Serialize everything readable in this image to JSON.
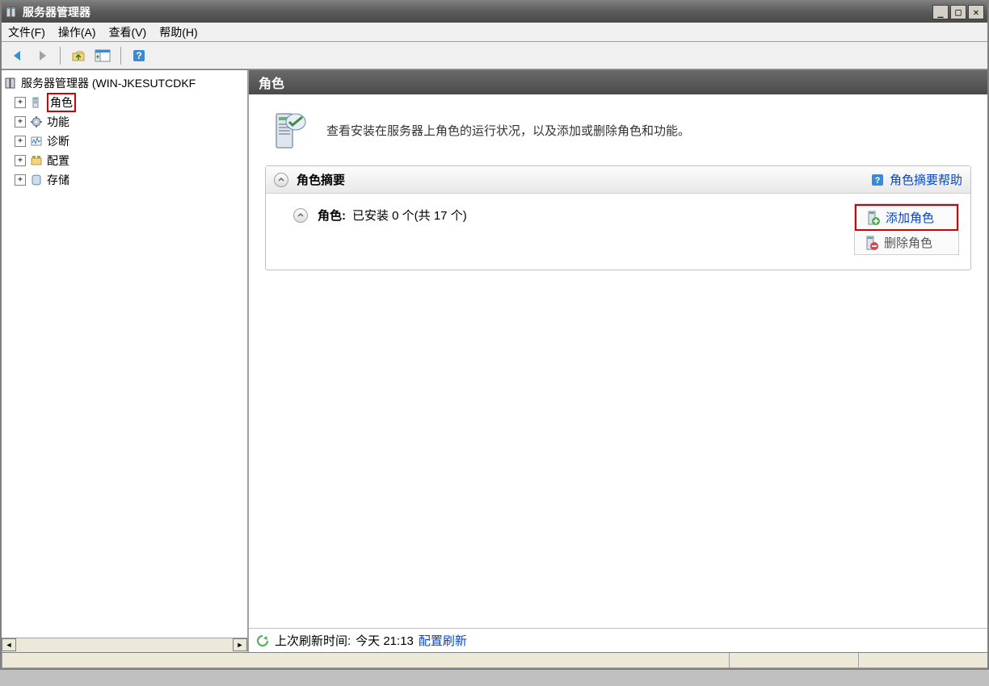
{
  "window": {
    "title": "服务器管理器"
  },
  "menubar": {
    "file": "文件(F)",
    "action": "操作(A)",
    "view": "查看(V)",
    "help": "帮助(H)"
  },
  "tree": {
    "root": "服务器管理器 (WIN-JKESUTCDKF",
    "items": {
      "roles": "角色",
      "features": "功能",
      "diagnostics": "诊断",
      "configuration": "配置",
      "storage": "存储"
    }
  },
  "main": {
    "header": "角色",
    "banner": "查看安装在服务器上角色的运行状况，以及添加或删除角色和功能。",
    "summary": {
      "title": "角色摘要",
      "help": "角色摘要帮助"
    },
    "roles": {
      "label": "角色:",
      "installed": "已安装 0 个(共 17 个)",
      "add": "添加角色",
      "remove": "删除角色"
    },
    "status": {
      "prefix": "上次刷新时间:",
      "time": "今天 21:13",
      "config": "配置刷新"
    }
  }
}
